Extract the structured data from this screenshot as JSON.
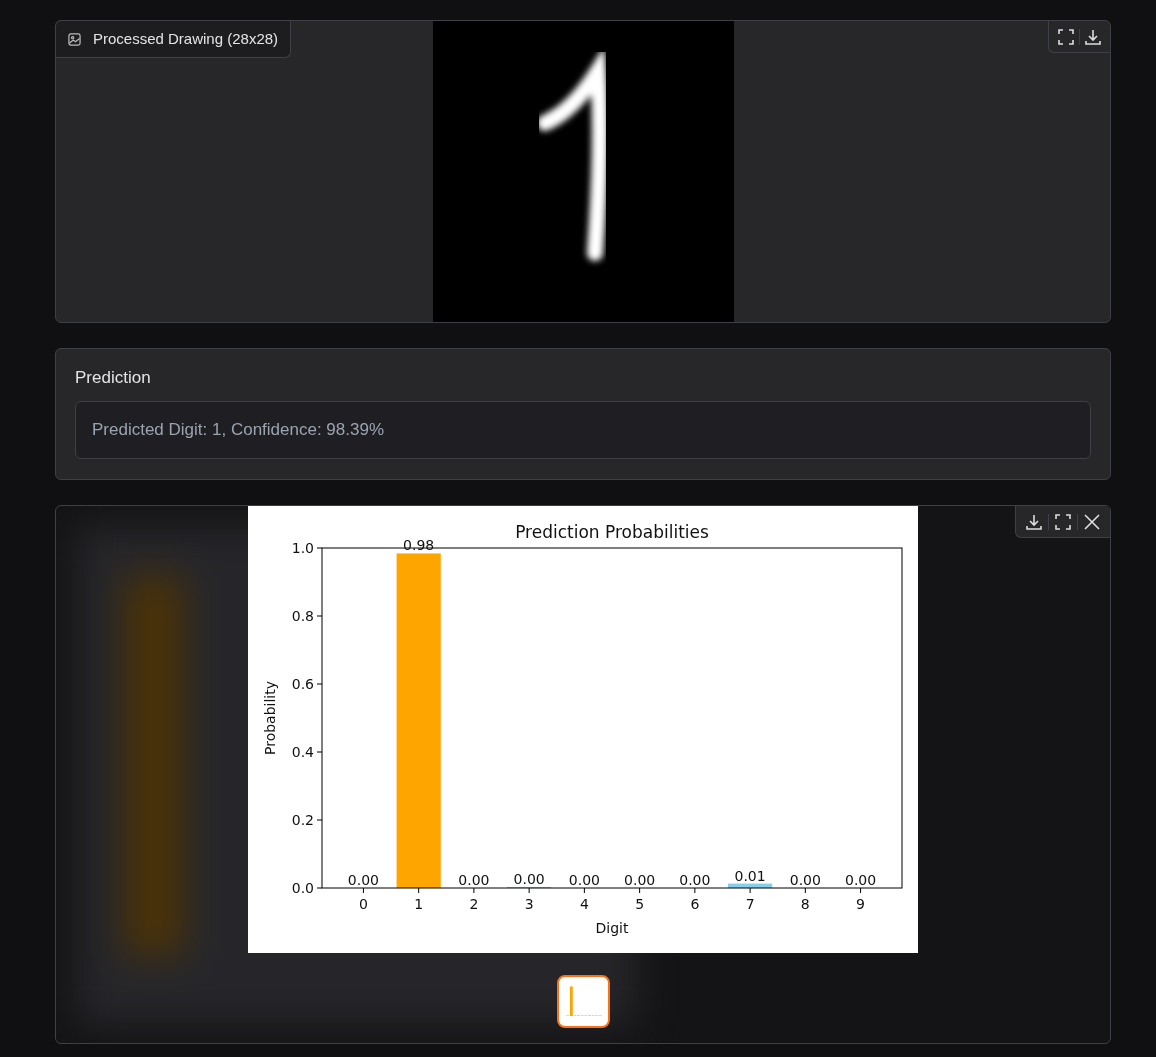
{
  "image_panel": {
    "label": "Processed Drawing (28x28)"
  },
  "prediction": {
    "label": "Prediction",
    "value": "Predicted Digit: 1, Confidence: 98.39%"
  },
  "gallery": {
    "chart_data": {
      "type": "bar",
      "title": "Prediction Probabilities",
      "xlabel": "Digit",
      "ylabel": "Probability",
      "categories": [
        "0",
        "1",
        "2",
        "3",
        "4",
        "5",
        "6",
        "7",
        "8",
        "9"
      ],
      "values": [
        0.0,
        0.984,
        0.0,
        0.003,
        0.0,
        0.0,
        0.0,
        0.013,
        0.0,
        0.0
      ],
      "colors": [
        "#87ceeb",
        "#ffa500",
        "#87ceeb",
        "#87ceeb",
        "#87ceeb",
        "#87ceeb",
        "#87ceeb",
        "#87ceeb",
        "#87ceeb",
        "#87ceeb"
      ],
      "ylim": [
        0,
        1
      ],
      "yticks": [
        {
          "value": 0,
          "label": "0.0"
        },
        {
          "value": 0.2,
          "label": "0.2"
        },
        {
          "value": 0.4,
          "label": "0.4"
        },
        {
          "value": 0.6,
          "label": "0.6"
        },
        {
          "value": 0.8,
          "label": "0.8"
        },
        {
          "value": 1,
          "label": "1.0"
        }
      ],
      "value_labels": [
        "0.00",
        "0.98",
        "0.00",
        "0.00",
        "0.00",
        "0.00",
        "0.00",
        "0.01",
        "0.00",
        "0.00"
      ]
    },
    "thumbnails": [
      {
        "selected": true
      }
    ]
  }
}
